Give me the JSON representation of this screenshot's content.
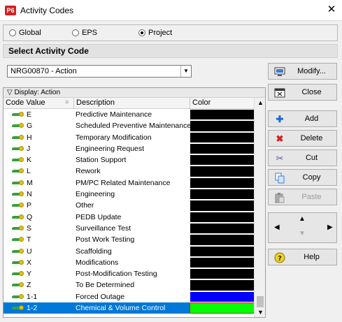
{
  "window": {
    "title": "Activity Codes",
    "app_badge": "P6",
    "close_glyph": "✕"
  },
  "scope": {
    "options": [
      "Global",
      "EPS",
      "Project"
    ],
    "selected": "Project"
  },
  "section_title": "Select Activity Code",
  "activity_code_select": {
    "value": "NRG00870 - Action"
  },
  "buttons": {
    "modify": "Modify...",
    "close": "Close",
    "add": "Add",
    "delete": "Delete",
    "cut": "Cut",
    "copy": "Copy",
    "paste": "Paste",
    "help": "Help"
  },
  "grid": {
    "display_label": "Display: Action",
    "columns": [
      "Code Value",
      "Description",
      "Color"
    ],
    "rows": [
      {
        "code": "E",
        "description": "Predictive Maintenance",
        "color": "#000000"
      },
      {
        "code": "G",
        "description": "Scheduled Preventive Maintenance",
        "color": "#000000"
      },
      {
        "code": "H",
        "description": "Temporary Modification",
        "color": "#000000"
      },
      {
        "code": "J",
        "description": "Engineering Request",
        "color": "#000000"
      },
      {
        "code": "K",
        "description": "Station Support",
        "color": "#000000"
      },
      {
        "code": "L",
        "description": "Rework",
        "color": "#000000"
      },
      {
        "code": "M",
        "description": "PM/PC Related Maintenance",
        "color": "#000000"
      },
      {
        "code": "N",
        "description": "Engineering",
        "color": "#000000"
      },
      {
        "code": "P",
        "description": "Other",
        "color": "#000000"
      },
      {
        "code": "Q",
        "description": "PEDB Update",
        "color": "#000000"
      },
      {
        "code": "S",
        "description": "Surveillance Test",
        "color": "#000000"
      },
      {
        "code": "T",
        "description": "Post Work Testing",
        "color": "#000000"
      },
      {
        "code": "U",
        "description": "Scaffolding",
        "color": "#000000"
      },
      {
        "code": "X",
        "description": "Modifications",
        "color": "#000000"
      },
      {
        "code": "Y",
        "description": "Post-Modification Testing",
        "color": "#000000"
      },
      {
        "code": "Z",
        "description": "To Be Determined",
        "color": "#000000"
      },
      {
        "code": "1-1",
        "description": "Forced Outage",
        "color": "#0000ff"
      },
      {
        "code": "1-2",
        "description": "Chemical & Volume Control",
        "color": "#00ff00",
        "selected": true
      }
    ]
  },
  "colors": {
    "selection": "#0078d7",
    "accent_red": "#d42020"
  }
}
